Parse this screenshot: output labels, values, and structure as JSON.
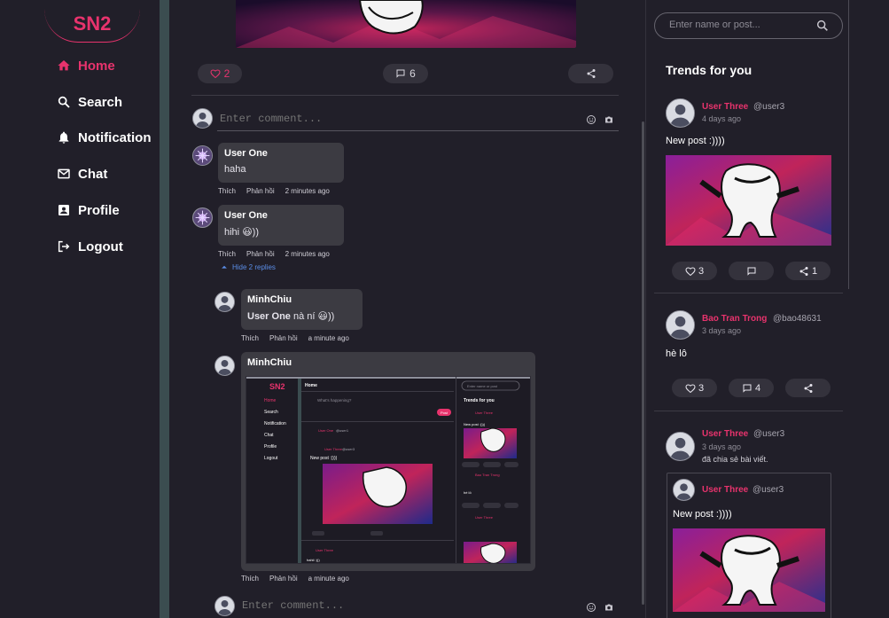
{
  "brand": {
    "logo": "SN2",
    "accent": "#e8336d"
  },
  "sidebar": {
    "items": [
      {
        "label": "Home",
        "icon": "home-icon",
        "active": true
      },
      {
        "label": "Search",
        "icon": "search-icon",
        "active": false
      },
      {
        "label": "Notification",
        "icon": "bell-icon",
        "active": false
      },
      {
        "label": "Chat",
        "icon": "mail-icon",
        "active": false
      },
      {
        "label": "Profile",
        "icon": "profile-card-icon",
        "active": false
      },
      {
        "label": "Logout",
        "icon": "logout-icon",
        "active": false
      }
    ]
  },
  "post": {
    "likes": "2",
    "comments": "6",
    "comment_placeholder": "Enter comment..."
  },
  "comments": [
    {
      "author": "User One",
      "text": "haha",
      "like": "Thích",
      "reply": "Phản hồi",
      "time": "2 minutes ago"
    },
    {
      "author": "User One",
      "text": "hihi",
      "emoji": "😃",
      "text_after": "))",
      "like": "Thích",
      "reply": "Phản hồi",
      "time": "2 minutes ago",
      "toggle": "Hide 2 replies"
    }
  ],
  "replies": [
    {
      "author": "MinhChiu",
      "mention": "User One",
      "text": " nà ní ",
      "emoji": "😃",
      "text_after": "))",
      "like": "Thích",
      "reply": "Phản hồi",
      "time": "a minute ago"
    },
    {
      "author": "MinhChiu",
      "like": "Thích",
      "reply": "Phản hồi",
      "time": "a minute ago"
    }
  ],
  "reply_input_placeholder": "Enter comment...",
  "embedded_screenshot": {
    "logo": "SN2",
    "nav": [
      "Home",
      "Search",
      "Notification",
      "Chat",
      "Profile",
      "Logout"
    ],
    "header": "Home",
    "whats_happening": "What's happening?",
    "post_button": "Post",
    "trends": "Trends for you",
    "search": "Enter name or post",
    "feed_user": "User One",
    "feed_handle": "@user1",
    "feed_user2": "User Three",
    "feed_handle2": "@user3",
    "feed_text": "New post :))))",
    "trend_user": "User Three",
    "trend_text": "New post :))))",
    "trend_user2": "Bao Tran Trong",
    "trend_text2": "hè lô",
    "footer_text": "hahii :)))"
  },
  "right": {
    "search_placeholder": "Enter name or post...",
    "title": "Trends for you",
    "trends": [
      {
        "name": "User Three",
        "handle": "@user3",
        "time": "4 days ago",
        "text": "New post :))))",
        "likes": "3",
        "comments": "",
        "shares": "1"
      },
      {
        "name": "Bao Tran Trong",
        "handle": "@bao48631",
        "time": "3 days ago",
        "text": "hè lô",
        "likes": "3",
        "comments": "4",
        "shares": ""
      },
      {
        "name": "User Three",
        "handle": "@user3",
        "time": "3 days ago",
        "text": "đã chia sẻ bài viết.",
        "shared": {
          "name": "User Three",
          "handle": "@user3",
          "text": "New post :))))"
        }
      }
    ]
  }
}
